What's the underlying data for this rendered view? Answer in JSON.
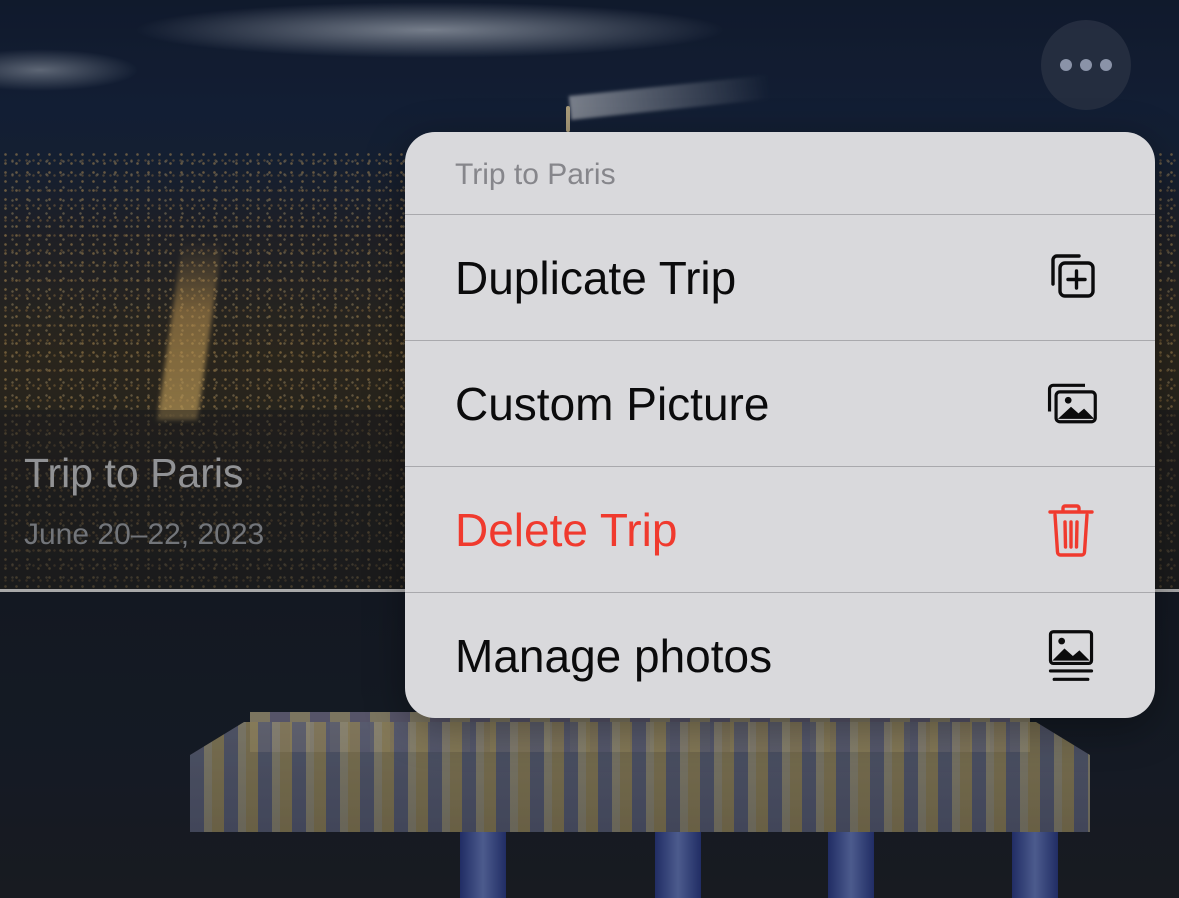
{
  "trip_card": {
    "title": "Trip to Paris",
    "dates": "June 20–22, 2023"
  },
  "more_button": {
    "icon": "ellipsis-icon"
  },
  "context_menu": {
    "header": "Trip to Paris",
    "items": [
      {
        "label": "Duplicate Trip",
        "icon": "duplicate-plus-icon",
        "destructive": false
      },
      {
        "label": "Custom Picture",
        "icon": "photo-stack-icon",
        "destructive": false
      },
      {
        "label": "Delete Trip",
        "icon": "trash-icon",
        "destructive": true
      },
      {
        "label": "Manage photos",
        "icon": "photo-caption-icon",
        "destructive": false
      }
    ]
  },
  "colors": {
    "menu_background": "#d9d9dc",
    "destructive": "#f03a2e",
    "menu_text": "#0b0b0c",
    "header_text": "#86868b"
  }
}
